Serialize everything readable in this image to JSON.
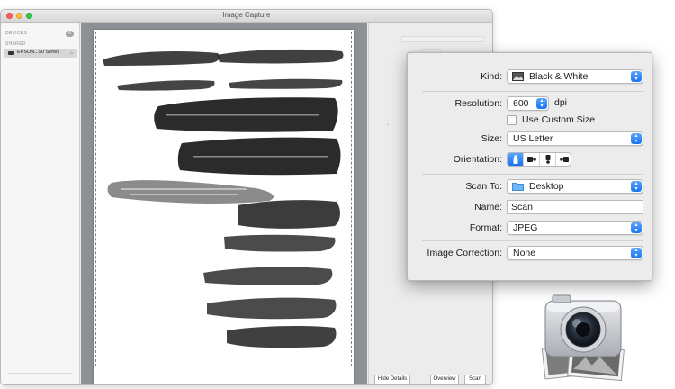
{
  "window": {
    "title": "Image Capture"
  },
  "sidebar": {
    "devices_header": "DEVICES",
    "devices_count": "0",
    "shared_header": "SHARED",
    "item_label": "EPSON...50 Series"
  },
  "buttons": {
    "hide_details": "Hide Details",
    "overview": "Overview",
    "scan": "Scan"
  },
  "panel": {
    "kind_label": "Kind:",
    "kind_value": "Black & White",
    "resolution_label": "Resolution:",
    "resolution_value": "600",
    "resolution_unit": "dpi",
    "custom_size_label": "Use Custom Size",
    "custom_size_checked": false,
    "size_label": "Size:",
    "size_value": "US Letter",
    "orientation_label": "Orientation:",
    "orientation_selected": 0,
    "scan_to_label": "Scan To:",
    "scan_to_value": "Desktop",
    "name_label": "Name:",
    "name_value": "Scan",
    "format_label": "Format:",
    "format_value": "JPEG",
    "image_correction_label": "Image Correction:",
    "image_correction_value": "None"
  },
  "colors": {
    "accent": "#1a73f0",
    "preview_background": "#8d9094",
    "window_background": "#ececec"
  },
  "icons": {
    "kind": "black-white-photo-icon",
    "scan_to": "folder-icon",
    "app": "image-capture-app-icon"
  }
}
